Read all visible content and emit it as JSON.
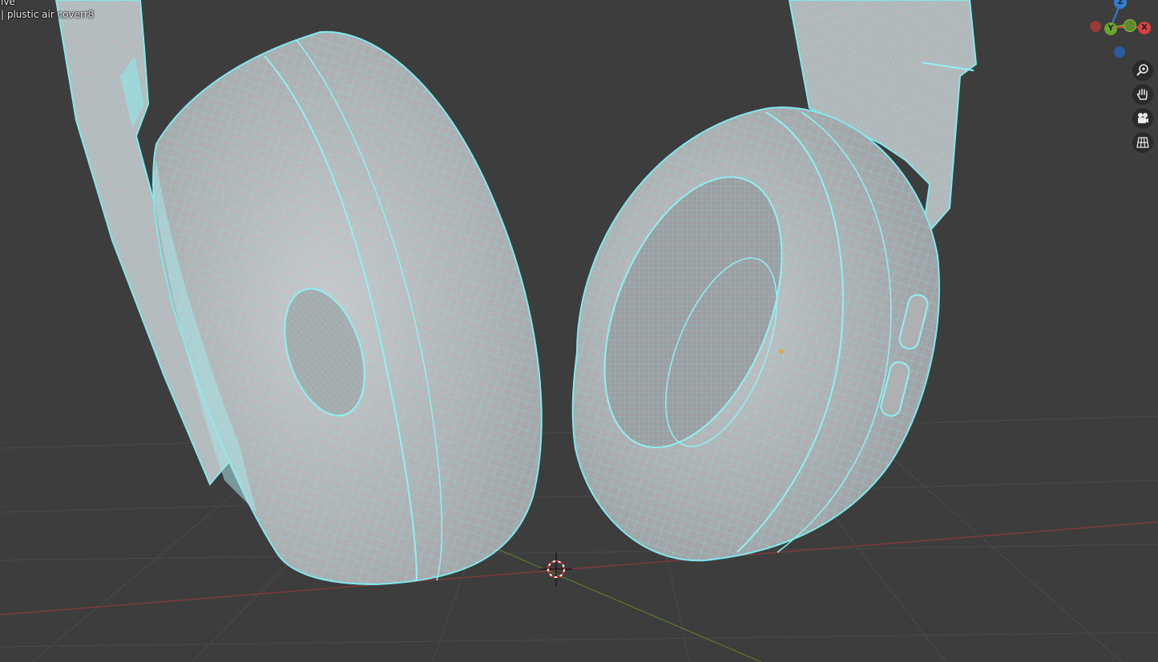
{
  "viewport": {
    "mode_text": "ive",
    "active_object_text": "| plustic air coverr8"
  },
  "gizmo": {
    "axes": [
      {
        "key": "z",
        "label": "Z",
        "color": "#2f7fd6"
      },
      {
        "key": "y",
        "label": "Y",
        "color": "#6ea42a"
      },
      {
        "key": "x",
        "label": "X",
        "color": "#d5423f"
      },
      {
        "key": "neg_x",
        "label": "",
        "color": "#9a3a39"
      },
      {
        "key": "neg_y",
        "label": "",
        "color": "#5f8a2a"
      },
      {
        "key": "neg_z",
        "label": "",
        "color": "#2b5d9c"
      }
    ]
  },
  "toolbar": {
    "tools": [
      {
        "name": "zoom-icon",
        "tooltip": "Zoom"
      },
      {
        "name": "pan-hand-icon",
        "tooltip": "Move"
      },
      {
        "name": "camera-icon",
        "tooltip": "Toggle camera view"
      },
      {
        "name": "grid-perspective-icon",
        "tooltip": "Toggle perspective"
      }
    ]
  },
  "colors": {
    "background": "#3d3d3d",
    "wire": "#7fe9ee",
    "mesh_fill": "#bdbdbf",
    "x_axis": "#8a3a3a",
    "y_axis": "#5c7a2a"
  }
}
